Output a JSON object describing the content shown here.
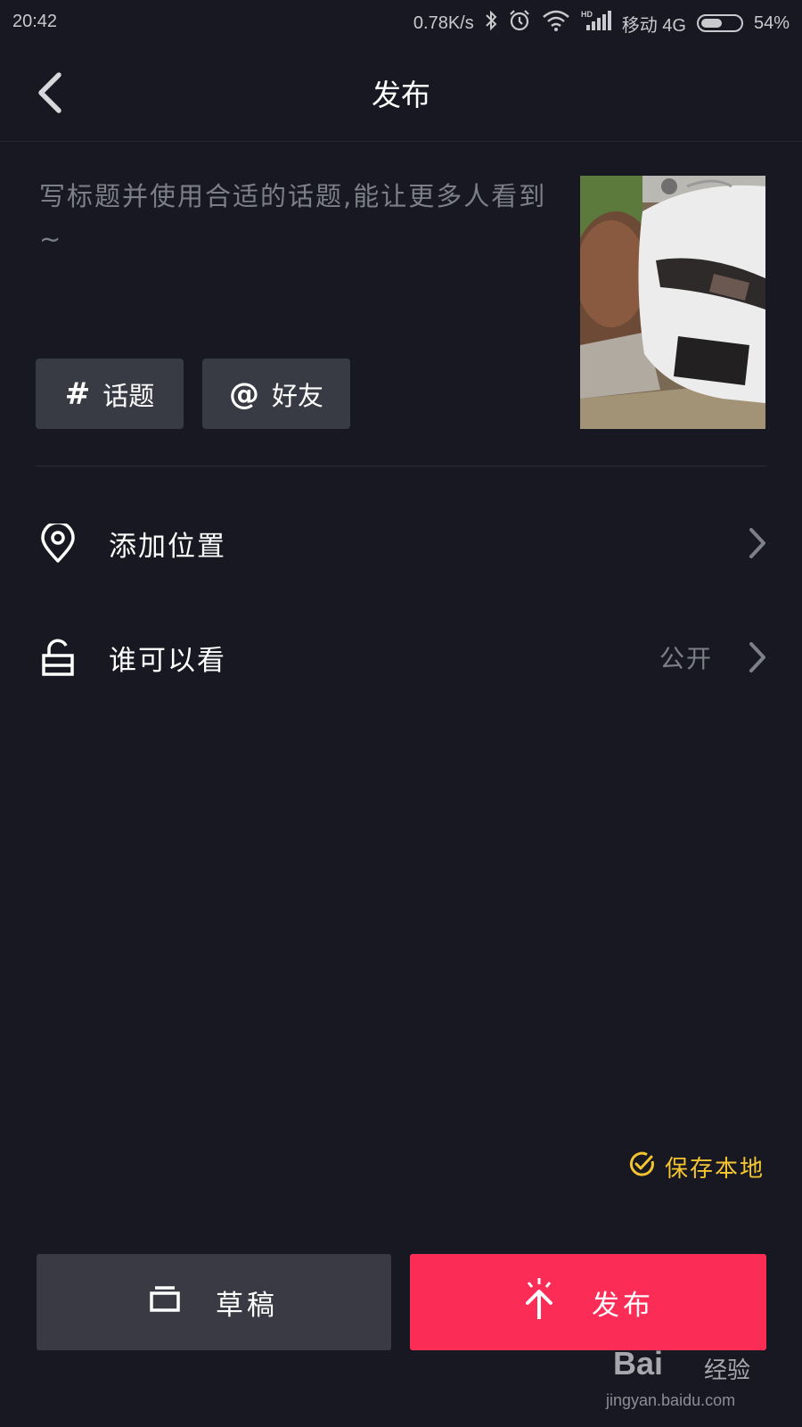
{
  "status_bar": {
    "time": "20:42",
    "network_speed": "0.78K/s",
    "carrier": "移动 4G",
    "battery_percent": "54%",
    "battery_level": 0.54,
    "icons": [
      "bluetooth-icon",
      "alarm-icon",
      "wifi-icon",
      "hd-signal-icon",
      "battery-icon"
    ]
  },
  "header": {
    "title": "发布",
    "back_icon": "chevron-left-icon"
  },
  "caption": {
    "placeholder": "写标题并使用合适的话题,能让更多人看到~"
  },
  "chips": {
    "topic_icon": "#",
    "topic_label": "话题",
    "friend_icon": "@",
    "friend_label": "好友"
  },
  "rows": {
    "location_label": "添加位置",
    "visibility_label": "谁可以看",
    "visibility_value": "公开"
  },
  "save_local": {
    "label": "保存本地",
    "checked": true,
    "color": "#f4c531"
  },
  "actions": {
    "draft_label": "草稿",
    "publish_label": "发布",
    "publish_color": "#fb2c56"
  },
  "watermark": {
    "brand": "Bai",
    "brand_cn": "经验",
    "url": "jingyan.baidu.com"
  }
}
